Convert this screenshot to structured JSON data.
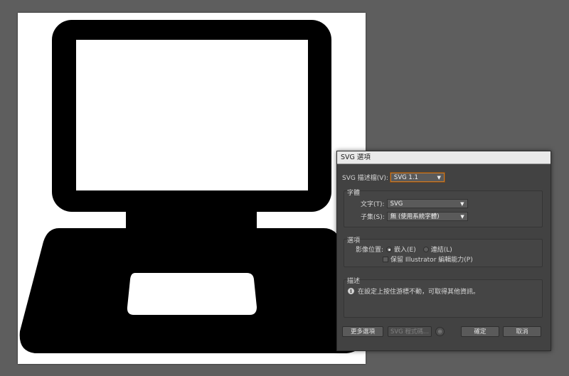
{
  "dialog": {
    "title": "SVG 選項",
    "profile_label": "SVG 描述檔(V):",
    "profile_value": "SVG 1.1",
    "font_group": {
      "title": "字體",
      "type_label": "文字(T):",
      "type_value": "SVG",
      "subset_label": "子集(S):",
      "subset_value": "無 (使用系統字體)"
    },
    "options_group": {
      "title": "選項",
      "image_location_label": "影像位置:",
      "embed_label": "嵌入(E)",
      "link_label": "連結(L)",
      "preserve_label": "保留 Illustrator 編輯能力(P)"
    },
    "description_group": {
      "title": "描述",
      "text": "在設定上按住游標不動，可取得其他資訊。"
    },
    "buttons": {
      "more_options": "更多選項",
      "svg_code": "SVG 程式碼...",
      "ok": "確定",
      "cancel": "取消"
    }
  },
  "colors": {
    "background": "#5e5e5e",
    "artboard": "#ffffff",
    "artwork": "#000000",
    "dialog": "#424242",
    "focus": "#c87a2a"
  },
  "icons": {
    "artwork": "laptop-icon",
    "info": "info-icon",
    "web": "web-icon"
  }
}
